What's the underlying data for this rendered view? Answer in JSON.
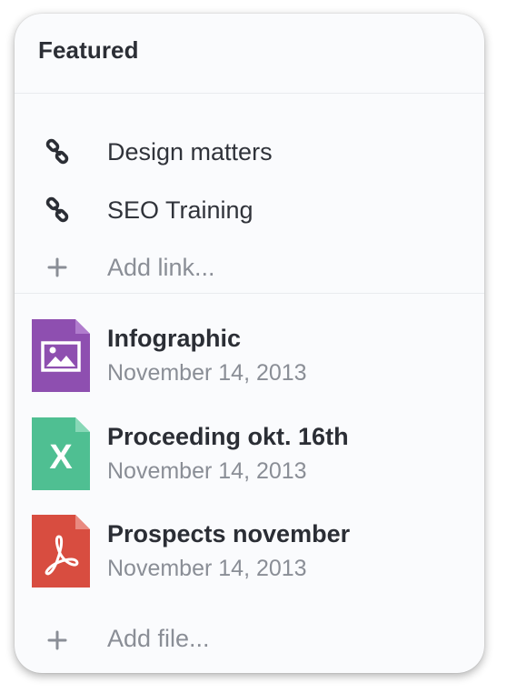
{
  "panel": {
    "title": "Featured"
  },
  "links": {
    "items": [
      {
        "label": "Design matters",
        "icon": "link-icon"
      },
      {
        "label": "SEO Training",
        "icon": "link-icon"
      }
    ],
    "add_label": "Add link..."
  },
  "files": {
    "items": [
      {
        "name": "Infographic",
        "date": "November 14, 2013",
        "type": "image",
        "icon": "image-file-icon",
        "color": "#8e4fb0"
      },
      {
        "name": "Proceeding okt. 16th",
        "date": "November 14, 2013",
        "type": "spreadsheet",
        "icon": "excel-file-icon",
        "color": "#4fbf92",
        "glyph": "X"
      },
      {
        "name": "Prospects november",
        "date": "November 14, 2013",
        "type": "pdf",
        "icon": "pdf-file-icon",
        "color": "#d84d40"
      }
    ],
    "add_label": "Add file..."
  },
  "colors": {
    "card_bg": "#fafbfd",
    "text_primary": "#2b2e35",
    "text_muted": "#8a8e96",
    "divider": "#e9ebef"
  }
}
